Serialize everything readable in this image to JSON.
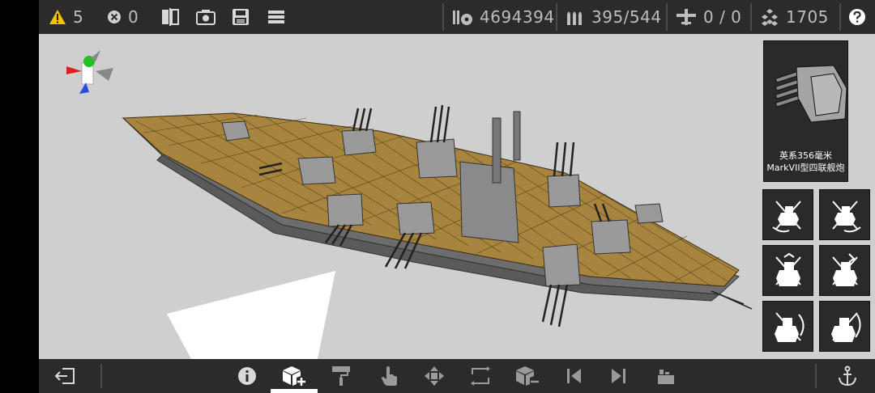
{
  "topbar": {
    "warnings": "5",
    "errors": "0",
    "mass": "4694394",
    "ammo": "395/544",
    "aircraft": "0 / 0",
    "cost": "1705"
  },
  "part_panel": {
    "name": "英系356毫米MarkVII型四联舰炮"
  },
  "colors": {
    "bar_bg": "#2b2b2b",
    "viewport_bg": "#cfcfcf",
    "deck": "#a8853e",
    "hull": "#6e6e6e",
    "warning": "#f0c400"
  }
}
